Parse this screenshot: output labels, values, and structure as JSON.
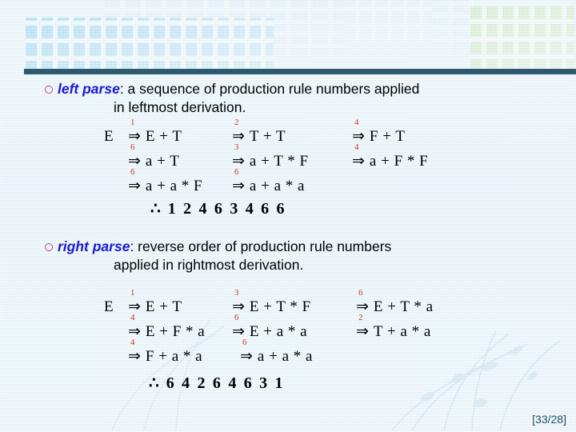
{
  "slide": {
    "page_number": "[33/28]"
  },
  "sections": [
    {
      "bullet_marker": "o",
      "term": "left parse",
      "definition": ":  a sequence of production rule numbers applied",
      "definition_cont": "in leftmost derivation.",
      "start_symbol": "E",
      "rows": [
        [
          {
            "rule": "1",
            "arrow": "⇒",
            "sentential": "E + T"
          },
          {
            "rule": "2",
            "arrow": "⇒",
            "sentential": "T + T"
          },
          {
            "rule": "4",
            "arrow": "⇒",
            "sentential": "F + T"
          }
        ],
        [
          {
            "rule": "6",
            "arrow": "⇒",
            "sentential": "a + T"
          },
          {
            "rule": "3",
            "arrow": "⇒",
            "sentential": "a + T * F"
          },
          {
            "rule": "4",
            "arrow": "⇒",
            "sentential": "a + F * F"
          }
        ],
        [
          {
            "rule": "6",
            "arrow": "⇒",
            "sentential": "a + a * F"
          },
          {
            "rule": "6",
            "arrow": "⇒",
            "sentential": "a + a * a"
          }
        ]
      ],
      "conclusion_symbol": "∴",
      "conclusion": "1 2 4 6 3 4 6 6"
    },
    {
      "bullet_marker": "o",
      "term": "right parse",
      "definition": ":  reverse order of production rule numbers",
      "definition_cont": "applied in rightmost derivation.",
      "start_symbol": "E",
      "rows": [
        [
          {
            "rule": "1",
            "arrow": "⇒",
            "sentential": "E + T"
          },
          {
            "rule": "3",
            "arrow": "⇒",
            "sentential": "E + T * F"
          },
          {
            "rule": "6",
            "arrow": "⇒",
            "sentential": "E + T * a"
          }
        ],
        [
          {
            "rule": "4",
            "arrow": "⇒",
            "sentential": "E + F * a"
          },
          {
            "rule": "6",
            "arrow": "⇒",
            "sentential": "E + a * a"
          },
          {
            "rule": "2",
            "arrow": "⇒",
            "sentential": "T + a * a"
          }
        ],
        [
          {
            "rule": "4",
            "arrow": "⇒",
            "sentential": "F + a * a"
          },
          {
            "rule": "6",
            "arrow": "⇒",
            "sentential": "a + a * a"
          }
        ]
      ],
      "conclusion_symbol": "∴",
      "conclusion": "6 4 2 6 4 6 3 1"
    }
  ],
  "theme": {
    "rule_bar_color": "#2b5a70",
    "term_color": "#1a1ad0",
    "bullet_color": "#c2409a",
    "rule_number_color": "#c0392b",
    "background_color": "#eaf4f8"
  }
}
